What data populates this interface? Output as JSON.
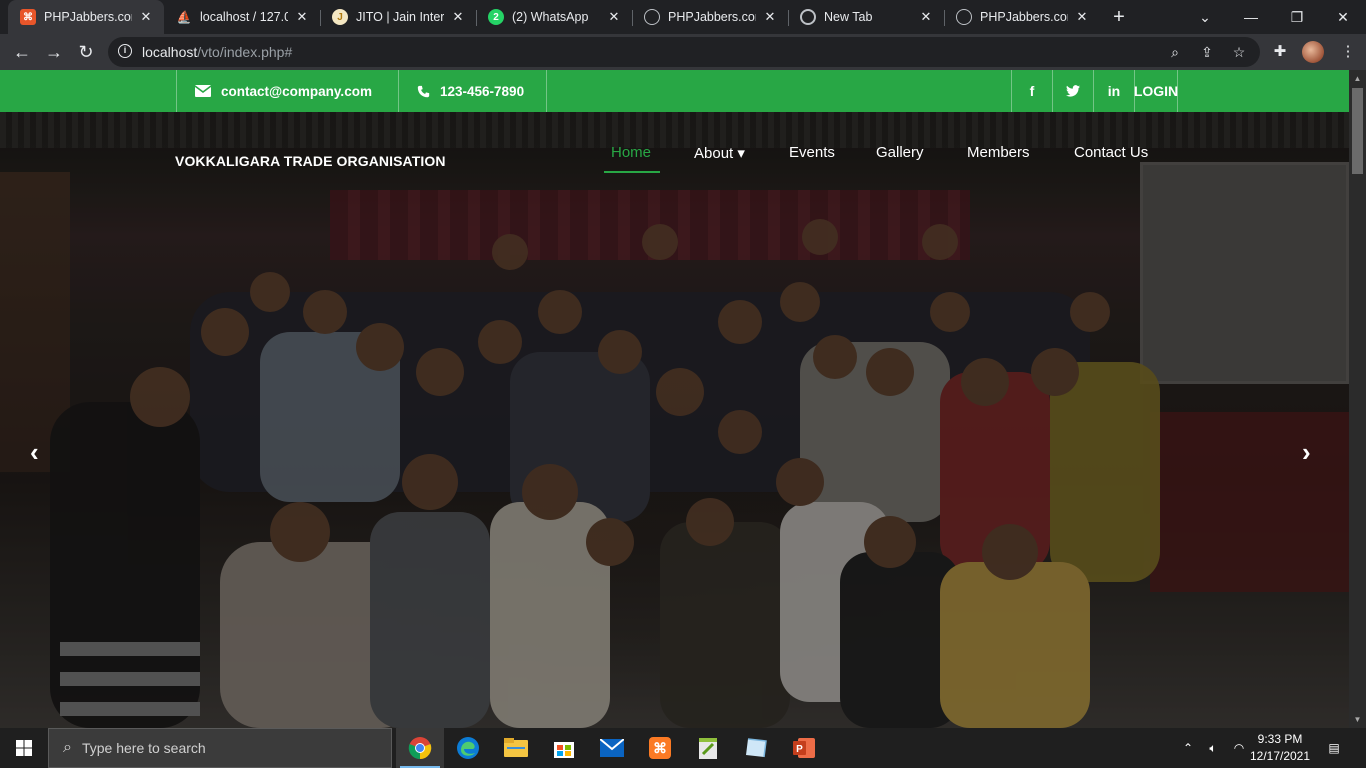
{
  "browser": {
    "tabs": [
      {
        "title": "PHPJabbers.com |",
        "favicon": "phpjabbers-icon",
        "fav_color": "#e8562a",
        "active": true
      },
      {
        "title": "localhost / 127.0.",
        "favicon": "phpmyadmin-icon",
        "fav_color": "#e8a23a",
        "active": false
      },
      {
        "title": "JITO | Jain Interna",
        "favicon": "jito-icon",
        "fav_color": "#d9a320",
        "active": false
      },
      {
        "title": "(2) WhatsApp",
        "favicon": "whatsapp-icon",
        "fav_color": "#25d366",
        "active": false
      },
      {
        "title": "PHPJabbers.com",
        "favicon": "globe-icon",
        "fav_color": "#9aa0a6",
        "active": false
      },
      {
        "title": "New Tab",
        "favicon": "chrome-icon",
        "fav_color": "#9aa0a6",
        "active": false
      },
      {
        "title": "PHPJabbers.com",
        "favicon": "globe-icon",
        "fav_color": "#9aa0a6",
        "active": false
      }
    ],
    "whatsapp_badge": "2",
    "url_host": "localhost",
    "url_path": "/vto/index.php#"
  },
  "site": {
    "topbar": {
      "email": "contact@company.com",
      "phone": "123-456-7890",
      "social": [
        "f",
        "t",
        "in"
      ],
      "login": "LOGIN"
    },
    "brand": "VOKKALIGARA TRADE ORGANISATION",
    "menu": [
      {
        "label": "Home",
        "active": true
      },
      {
        "label": "About ▾",
        "active": false
      },
      {
        "label": "Events",
        "active": false
      },
      {
        "label": "Gallery",
        "active": false
      },
      {
        "label": "Members",
        "active": false
      },
      {
        "label": "Contact Us",
        "active": false
      }
    ],
    "accent_color": "#28a745"
  },
  "taskbar": {
    "search_placeholder": "Type here to search",
    "time": "9:33 PM",
    "date": "12/17/2021"
  }
}
